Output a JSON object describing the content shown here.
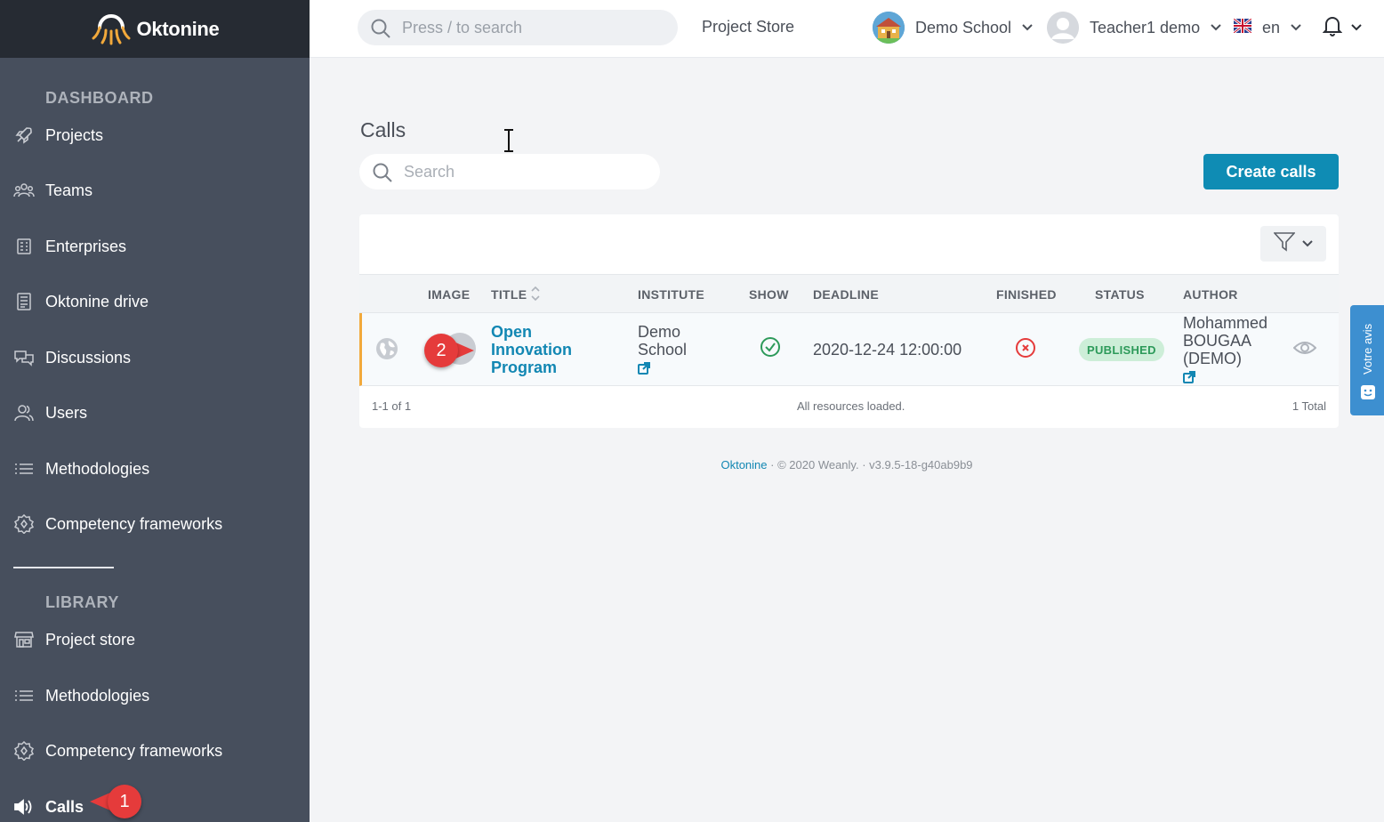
{
  "brand": {
    "name": "Oktonine"
  },
  "sidebar": {
    "dashboard_title": "DASHBOARD",
    "dashboard_items": [
      {
        "label": "Projects",
        "icon": "rocket-icon"
      },
      {
        "label": "Teams",
        "icon": "team-icon"
      },
      {
        "label": "Enterprises",
        "icon": "building-icon"
      },
      {
        "label": "Oktonine drive",
        "icon": "drive-icon"
      },
      {
        "label": "Discussions",
        "icon": "chat-icon"
      },
      {
        "label": "Users",
        "icon": "users-icon"
      },
      {
        "label": "Methodologies",
        "icon": "list-icon"
      },
      {
        "label": "Competency frameworks",
        "icon": "gear-badge-icon"
      }
    ],
    "library_title": "LIBRARY",
    "library_items": [
      {
        "label": "Project store",
        "icon": "store-icon"
      },
      {
        "label": "Methodologies",
        "icon": "list-icon"
      },
      {
        "label": "Competency frameworks",
        "icon": "gear-badge-icon"
      },
      {
        "label": "Calls",
        "icon": "speaker-icon",
        "active": true
      }
    ]
  },
  "topbar": {
    "search_placeholder": "Press / to search",
    "project_store": "Project Store",
    "school": "Demo School",
    "user": "Teacher1 demo",
    "language": "en"
  },
  "main": {
    "title": "Calls",
    "search_placeholder": "Search",
    "create_button": "Create calls"
  },
  "table": {
    "columns": [
      "IMAGE",
      "TITLE",
      "INSTITUTE",
      "SHOW",
      "DEADLINE",
      "FINISHED",
      "STATUS",
      "AUTHOR"
    ],
    "rows": [
      {
        "title_lines": [
          "Open",
          "Innovation",
          "Program"
        ],
        "institute_lines": [
          "Demo",
          "School"
        ],
        "show": true,
        "deadline": "2020-12-24 12:00:00",
        "finished": false,
        "status": "PUBLISHED",
        "author_lines": [
          "Mohammed",
          "BOUGAA",
          "(DEMO)"
        ]
      }
    ],
    "footer": {
      "range": "1-1 of 1",
      "message": "All resources loaded.",
      "total": "1 Total"
    }
  },
  "footer": {
    "brand_link": "Oktonine",
    "copyright": "© 2020 Weanly.",
    "version": "v3.9.5-18-g40ab9b9"
  },
  "feedback_tab": {
    "label": "Votre avis"
  },
  "callouts": {
    "one": "1",
    "two": "2"
  },
  "colors": {
    "sidebar": "#474f5d",
    "brand_bar": "#262b33",
    "accent": "#0f8cb4",
    "published": "#2d9a5a",
    "callout": "#e53b3b",
    "row_highlight": "#f2a93b"
  }
}
